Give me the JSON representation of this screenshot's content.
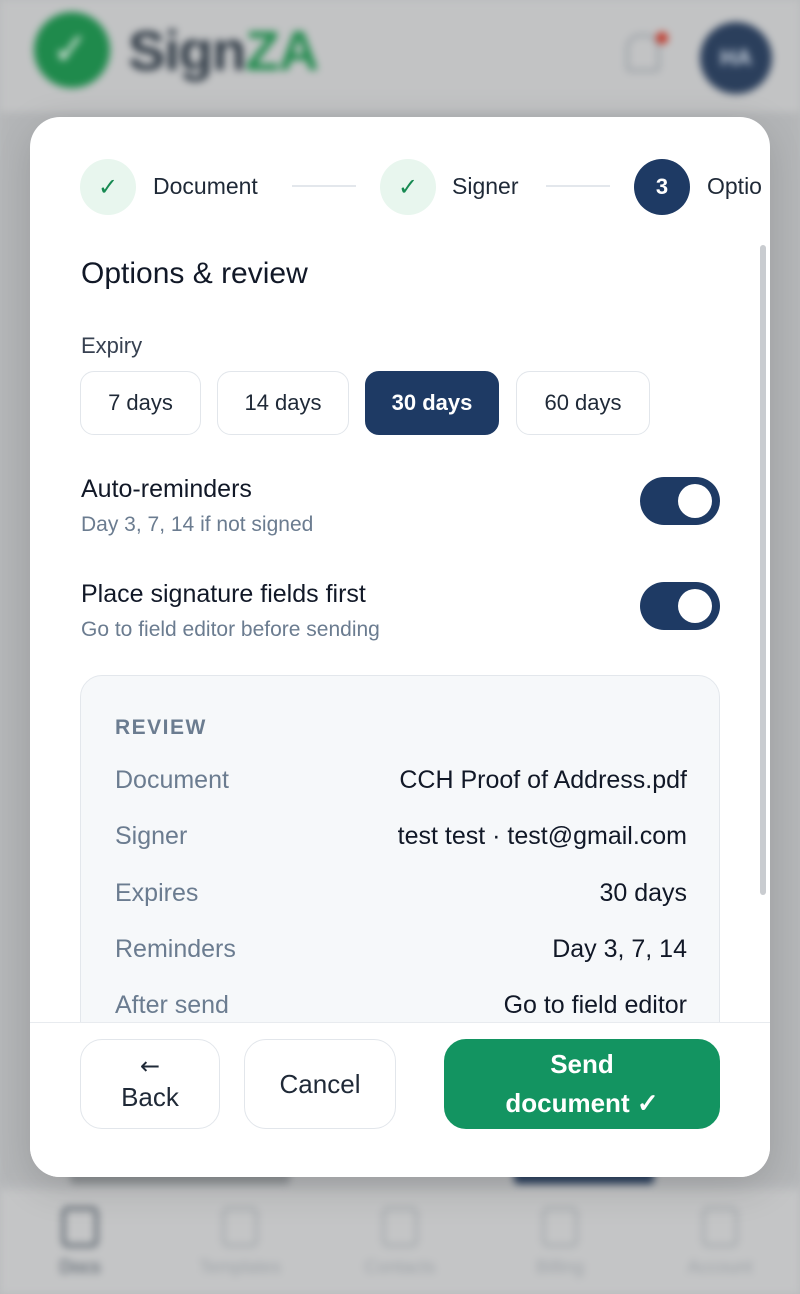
{
  "background": {
    "logo": {
      "text_part1": "Sign",
      "text_part2": "ZA"
    },
    "avatar_initials": "HA",
    "nav_items": [
      "Docs",
      "Templates",
      "Contacts",
      "Billing",
      "Account"
    ]
  },
  "stepper": {
    "steps": [
      {
        "label": "Document",
        "state": "done",
        "marker": "✓"
      },
      {
        "label": "Signer",
        "state": "done",
        "marker": "✓"
      },
      {
        "label": "Optio",
        "state": "current",
        "marker": "3"
      }
    ]
  },
  "options": {
    "title": "Options & review",
    "expiry_label": "Expiry",
    "expiry_options": [
      "7 days",
      "14 days",
      "30 days",
      "60 days"
    ],
    "expiry_selected": "30 days",
    "auto_reminders": {
      "title": "Auto-reminders",
      "subtitle": "Day 3, 7, 14 if not signed",
      "enabled": true
    },
    "place_fields": {
      "title": "Place signature fields first",
      "subtitle": "Go to field editor before sending",
      "enabled": true
    }
  },
  "review": {
    "heading": "REVIEW",
    "rows": [
      {
        "key": "Document",
        "value": "CCH Proof of Address.pdf"
      },
      {
        "key": "Signer",
        "value": "test test · test@gmail.com"
      },
      {
        "key": "Expires",
        "value": "30 days"
      },
      {
        "key": "Reminders",
        "value": "Day 3, 7, 14"
      },
      {
        "key": "After send",
        "value": "Go to field editor"
      }
    ]
  },
  "footer": {
    "back_arrow": "←",
    "back_label": "Back",
    "cancel_label": "Cancel",
    "send_line1": "Send",
    "send_line2": "document ✓"
  },
  "colors": {
    "primary_navy": "#1e3a64",
    "accent_green": "#139461",
    "muted_text": "#6b7c90"
  }
}
